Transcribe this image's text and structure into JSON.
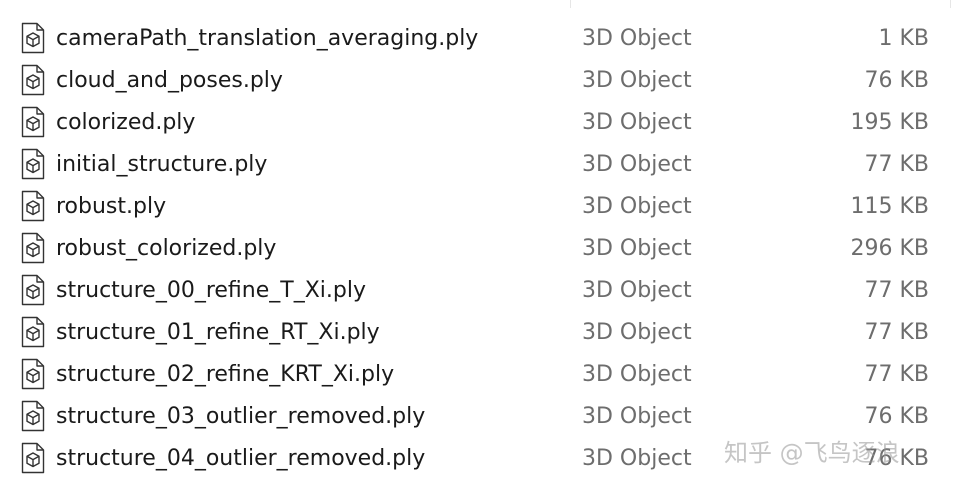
{
  "files": [
    {
      "name": "cameraPath_translation_averaging.ply",
      "type": "3D Object",
      "size": "1 KB",
      "icon": "3d-object-file-icon"
    },
    {
      "name": "cloud_and_poses.ply",
      "type": "3D Object",
      "size": "76 KB",
      "icon": "3d-object-file-icon"
    },
    {
      "name": "colorized.ply",
      "type": "3D Object",
      "size": "195 KB",
      "icon": "3d-object-file-icon"
    },
    {
      "name": "initial_structure.ply",
      "type": "3D Object",
      "size": "77 KB",
      "icon": "3d-object-file-icon"
    },
    {
      "name": "robust.ply",
      "type": "3D Object",
      "size": "115 KB",
      "icon": "3d-object-file-icon"
    },
    {
      "name": "robust_colorized.ply",
      "type": "3D Object",
      "size": "296 KB",
      "icon": "3d-object-file-icon"
    },
    {
      "name": "structure_00_refine_T_Xi.ply",
      "type": "3D Object",
      "size": "77 KB",
      "icon": "3d-object-file-icon"
    },
    {
      "name": "structure_01_refine_RT_Xi.ply",
      "type": "3D Object",
      "size": "77 KB",
      "icon": "3d-object-file-icon"
    },
    {
      "name": "structure_02_refine_KRT_Xi.ply",
      "type": "3D Object",
      "size": "77 KB",
      "icon": "3d-object-file-icon"
    },
    {
      "name": "structure_03_outlier_removed.ply",
      "type": "3D Object",
      "size": "76 KB",
      "icon": "3d-object-file-icon"
    },
    {
      "name": "structure_04_outlier_removed.ply",
      "type": "3D Object",
      "size": "76 KB",
      "icon": "3d-object-file-icon"
    }
  ],
  "watermark": "知乎 @飞鸟逐浪"
}
